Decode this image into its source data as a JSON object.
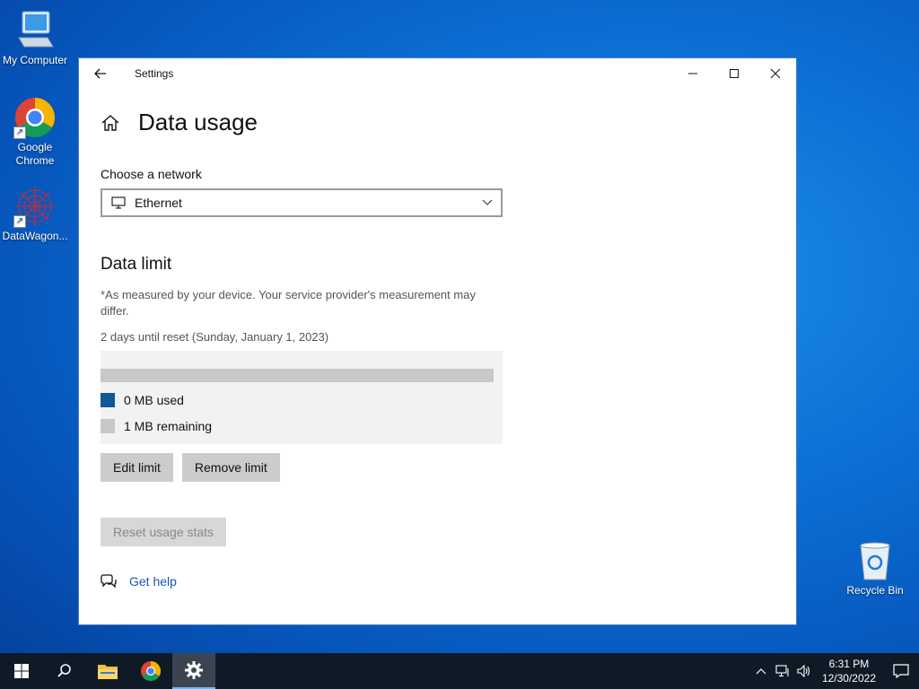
{
  "desktop": {
    "icons": [
      {
        "label": "My Computer"
      },
      {
        "label": "Google Chrome"
      },
      {
        "label": "DataWagon..."
      }
    ],
    "recycle_bin": "Recycle Bin"
  },
  "window": {
    "title": "Settings",
    "controls": [
      "minimize",
      "maximize",
      "close"
    ]
  },
  "page": {
    "title": "Data usage",
    "network_label": "Choose a network",
    "network_selected": "Ethernet",
    "data_limit": {
      "title": "Data limit",
      "note": "*As measured by your device. Your service provider's measurement may differ.",
      "reset_info": "2 days until reset (Sunday, January 1, 2023)",
      "used_fraction": 0,
      "used_label": "0 MB used",
      "remaining_label": "1 MB remaining",
      "used_color": "#0f5a96",
      "remaining_color": "#c8c8c8"
    },
    "buttons": {
      "edit_limit": "Edit limit",
      "remove_limit": "Remove limit",
      "reset_stats": "Reset usage stats"
    },
    "help_link": "Get help"
  },
  "taskbar": {
    "time": "6:31 PM",
    "date": "12/30/2022"
  }
}
